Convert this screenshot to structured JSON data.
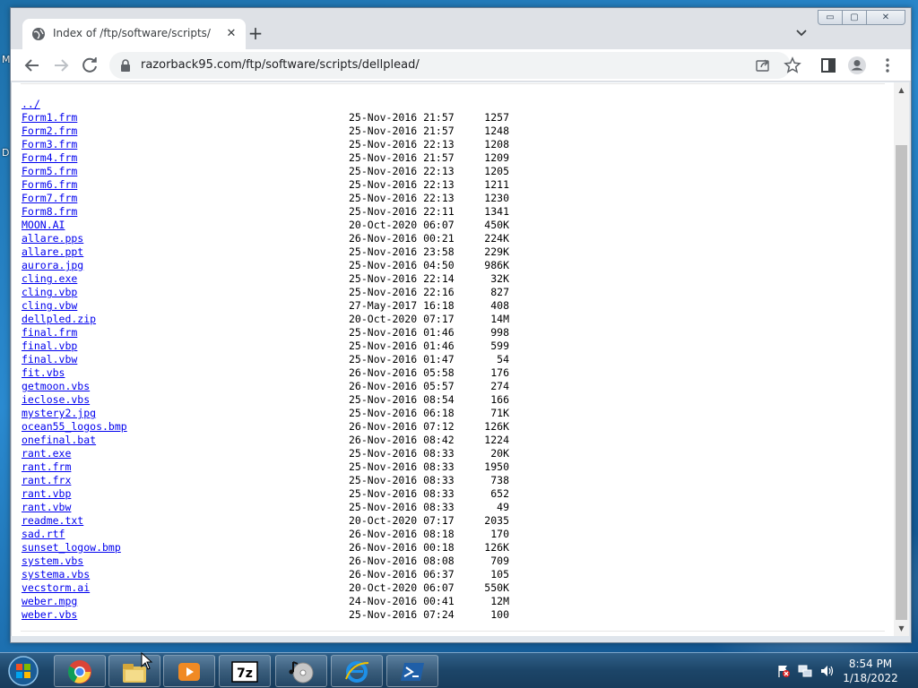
{
  "desktop": {
    "edge_letters": [
      "M",
      "D"
    ]
  },
  "browser": {
    "tab_title": "Index of /ftp/software/scripts/dellplead/",
    "tab_close": "✕",
    "new_tab": "+",
    "url": "razorback95.com/ftp/software/scripts/dellplead/",
    "window_controls": {
      "minimize": "▭",
      "maximize": "▢",
      "close": "✕"
    }
  },
  "listing": {
    "parent": "../",
    "files": [
      {
        "name": "Form1.frm",
        "date": "25-Nov-2016 21:57",
        "size": "1257"
      },
      {
        "name": "Form2.frm",
        "date": "25-Nov-2016 21:57",
        "size": "1248"
      },
      {
        "name": "Form3.frm",
        "date": "25-Nov-2016 22:13",
        "size": "1208"
      },
      {
        "name": "Form4.frm",
        "date": "25-Nov-2016 21:57",
        "size": "1209"
      },
      {
        "name": "Form5.frm",
        "date": "25-Nov-2016 22:13",
        "size": "1205"
      },
      {
        "name": "Form6.frm",
        "date": "25-Nov-2016 22:13",
        "size": "1211"
      },
      {
        "name": "Form7.frm",
        "date": "25-Nov-2016 22:13",
        "size": "1230"
      },
      {
        "name": "Form8.frm",
        "date": "25-Nov-2016 22:11",
        "size": "1341"
      },
      {
        "name": "MOON.AI",
        "date": "20-Oct-2020 06:07",
        "size": "450K"
      },
      {
        "name": "allare.pps",
        "date": "26-Nov-2016 00:21",
        "size": "224K"
      },
      {
        "name": "allare.ppt",
        "date": "25-Nov-2016 23:58",
        "size": "229K"
      },
      {
        "name": "aurora.jpg",
        "date": "25-Nov-2016 04:50",
        "size": "986K"
      },
      {
        "name": "cling.exe",
        "date": "25-Nov-2016 22:14",
        "size": "32K"
      },
      {
        "name": "cling.vbp",
        "date": "25-Nov-2016 22:16",
        "size": "827"
      },
      {
        "name": "cling.vbw",
        "date": "27-May-2017 16:18",
        "size": "408"
      },
      {
        "name": "dellpled.zip",
        "date": "20-Oct-2020 07:17",
        "size": "14M"
      },
      {
        "name": "final.frm",
        "date": "25-Nov-2016 01:46",
        "size": "998"
      },
      {
        "name": "final.vbp",
        "date": "25-Nov-2016 01:46",
        "size": "599"
      },
      {
        "name": "final.vbw",
        "date": "25-Nov-2016 01:47",
        "size": "54"
      },
      {
        "name": "fit.vbs",
        "date": "26-Nov-2016 05:58",
        "size": "176"
      },
      {
        "name": "getmoon.vbs",
        "date": "26-Nov-2016 05:57",
        "size": "274"
      },
      {
        "name": "ieclose.vbs",
        "date": "25-Nov-2016 08:54",
        "size": "166"
      },
      {
        "name": "mystery2.jpg",
        "date": "25-Nov-2016 06:18",
        "size": "71K"
      },
      {
        "name": "ocean55_logos.bmp",
        "date": "26-Nov-2016 07:12",
        "size": "126K"
      },
      {
        "name": "onefinal.bat",
        "date": "26-Nov-2016 08:42",
        "size": "1224"
      },
      {
        "name": "rant.exe",
        "date": "25-Nov-2016 08:33",
        "size": "20K"
      },
      {
        "name": "rant.frm",
        "date": "25-Nov-2016 08:33",
        "size": "1950"
      },
      {
        "name": "rant.frx",
        "date": "25-Nov-2016 08:33",
        "size": "738"
      },
      {
        "name": "rant.vbp",
        "date": "25-Nov-2016 08:33",
        "size": "652"
      },
      {
        "name": "rant.vbw",
        "date": "25-Nov-2016 08:33",
        "size": "49"
      },
      {
        "name": "readme.txt",
        "date": "20-Oct-2020 07:17",
        "size": "2035"
      },
      {
        "name": "sad.rtf",
        "date": "26-Nov-2016 08:18",
        "size": "170"
      },
      {
        "name": "sunset_logow.bmp",
        "date": "26-Nov-2016 00:18",
        "size": "126K"
      },
      {
        "name": "system.vbs",
        "date": "26-Nov-2016 08:08",
        "size": "709"
      },
      {
        "name": "systema.vbs",
        "date": "26-Nov-2016 06:37",
        "size": "105"
      },
      {
        "name": "vecstorm.ai",
        "date": "20-Oct-2020 06:07",
        "size": "550K"
      },
      {
        "name": "weber.mpg",
        "date": "24-Nov-2016 00:41",
        "size": "12M"
      },
      {
        "name": "weber.vbs",
        "date": "25-Nov-2016 07:24",
        "size": "100"
      }
    ]
  },
  "taskbar": {
    "time": "8:54 PM",
    "date": "1/18/2022",
    "apps": [
      "chrome-icon",
      "file-explorer-icon",
      "media-player-icon",
      "7zip-icon",
      "media-center-icon",
      "internet-explorer-icon",
      "powershell-icon"
    ],
    "seven_zip_label": "7z"
  },
  "colors": {
    "link": "#0000ee",
    "taskbar": "#1c4568"
  }
}
